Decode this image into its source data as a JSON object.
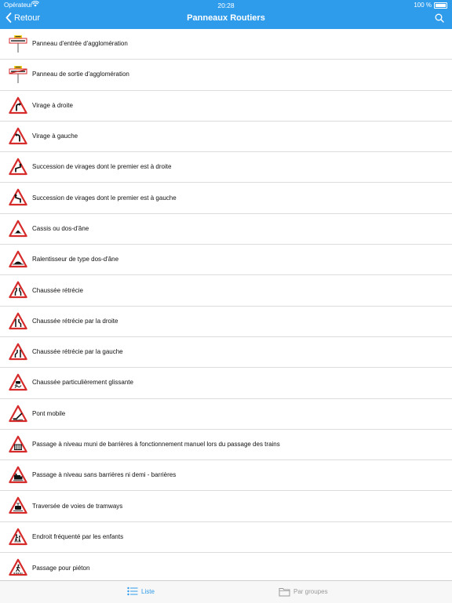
{
  "status": {
    "carrier": "Opérateur",
    "time": "20:28",
    "battery": "100 %"
  },
  "nav": {
    "back_label": "Retour",
    "title": "Panneaux Routiers"
  },
  "items": [
    {
      "label": "Panneau d'entrée d'agglomération",
      "icon": "town-entry"
    },
    {
      "label": "Panneau de sortie d'agglomération",
      "icon": "town-exit"
    },
    {
      "label": "Virage à droite",
      "icon": "curve-right"
    },
    {
      "label": "Virage à gauche",
      "icon": "curve-left"
    },
    {
      "label": "Succession de virages dont le premier est à droite",
      "icon": "double-curve-right"
    },
    {
      "label": "Succession de virages dont le premier est à gauche",
      "icon": "double-curve-left"
    },
    {
      "label": "Cassis ou dos-d'âne",
      "icon": "bump"
    },
    {
      "label": "Ralentisseur de type dos-d'âne",
      "icon": "speed-bump"
    },
    {
      "label": "Chaussée rétrécie",
      "icon": "road-narrows"
    },
    {
      "label": "Chaussée rétrécie par la droite",
      "icon": "road-narrows-right"
    },
    {
      "label": "Chaussée rétrécie par la gauche",
      "icon": "road-narrows-left"
    },
    {
      "label": "Chaussée particulièrement glissante",
      "icon": "slippery-road"
    },
    {
      "label": "Pont mobile",
      "icon": "movable-bridge"
    },
    {
      "label": "Passage à niveau muni de barrières à fonctionnement manuel lors du passage des trains",
      "icon": "level-crossing-barrier"
    },
    {
      "label": "Passage à niveau sans barrières ni demi - barrières",
      "icon": "level-crossing-train"
    },
    {
      "label": "Traversée de voies de tramways",
      "icon": "tramway"
    },
    {
      "label": "Endroit fréquenté par les enfants",
      "icon": "children"
    },
    {
      "label": "Passage pour piéton",
      "icon": "pedestrian"
    }
  ],
  "tabs": {
    "list_label": "Liste",
    "groups_label": "Par groupes"
  },
  "colors": {
    "accent": "#2f9ceb",
    "sign_red": "#d62b2b"
  }
}
